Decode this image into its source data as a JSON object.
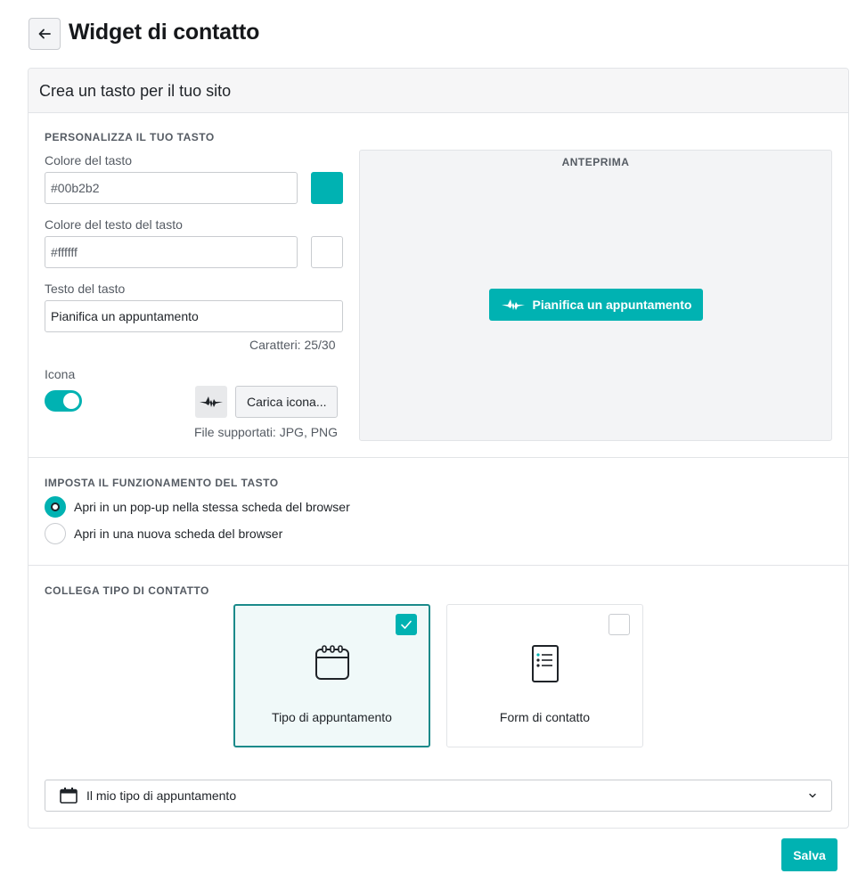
{
  "header": {
    "back_icon": "arrow-left-icon",
    "title": "Widget di contatto"
  },
  "card": {
    "title": "Crea un tasto per il tuo sito"
  },
  "customize": {
    "section_title": "PERSONALIZZA IL TUO TASTO",
    "button_color_label": "Colore del tasto",
    "button_color_value": "#00b2b2",
    "text_color_label": "Colore del testo del tasto",
    "text_color_value": "#ffffff",
    "button_text_label": "Testo del tasto",
    "button_text_value": "Pianifica un appuntamento",
    "char_count": "Caratteri: 25/30",
    "icon_label": "Icona",
    "icon_enabled": true,
    "upload_label": "Carica icona...",
    "supported_files": "File supportati: JPG, PNG"
  },
  "preview": {
    "label": "ANTEPRIMA",
    "button_label": "Pianifica un appuntamento",
    "button_color": "#00b2b2",
    "text_color": "#ffffff"
  },
  "behavior": {
    "section_title": "IMPOSTA IL FUNZIONAMENTO DEL TASTO",
    "options": [
      {
        "label": "Apri in un pop-up nella stessa scheda del browser",
        "selected": true
      },
      {
        "label": "Apri in una nuova scheda del browser",
        "selected": false
      }
    ]
  },
  "contact_type": {
    "section_title": "COLLEGA TIPO DI CONTATTO",
    "cards": [
      {
        "label": "Tipo di appuntamento",
        "icon": "calendar-icon",
        "checked": true
      },
      {
        "label": "Form di contatto",
        "icon": "form-list-icon",
        "checked": false
      }
    ],
    "select_value": "Il mio tipo di appuntamento",
    "select_icon": "calendar-icon"
  },
  "footer": {
    "save_label": "Salva"
  },
  "colors": {
    "accent": "#00b2b2",
    "selected_border": "#1b8a8a"
  }
}
